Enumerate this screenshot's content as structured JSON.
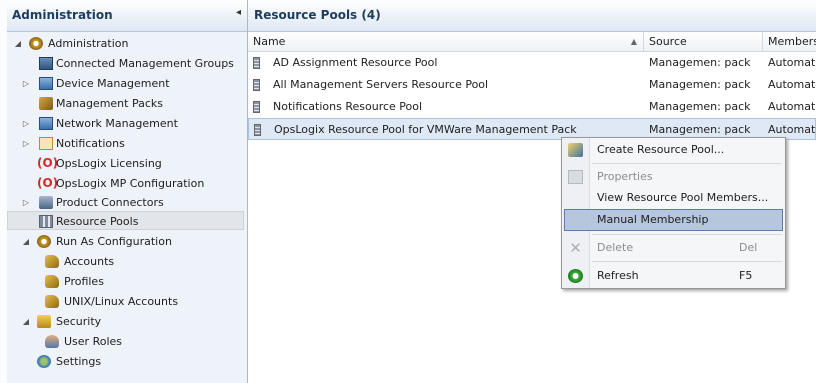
{
  "nav": {
    "title": "Administration",
    "items": [
      {
        "label": "Administration",
        "icon": "gear-icon",
        "expander": "expanded"
      },
      {
        "label": "Connected Management Groups",
        "icon": "management-groups-icon",
        "expander": ""
      },
      {
        "label": "Device Management",
        "icon": "device-icon",
        "expander": "collapsed"
      },
      {
        "label": "Management Packs",
        "icon": "pack-icon",
        "expander": ""
      },
      {
        "label": "Network Management",
        "icon": "network-icon",
        "expander": "collapsed"
      },
      {
        "label": "Notifications",
        "icon": "notification-icon",
        "expander": "collapsed"
      },
      {
        "label": "OpsLogix Licensing",
        "icon": "opslogix-icon",
        "expander": ""
      },
      {
        "label": "OpsLogix MP Configuration",
        "icon": "opslogix-icon",
        "expander": ""
      },
      {
        "label": "Product Connectors",
        "icon": "connector-icon",
        "expander": "collapsed"
      },
      {
        "label": "Resource Pools",
        "icon": "resource-pool-icon",
        "expander": "",
        "selected": true
      },
      {
        "label": "Run As Configuration",
        "icon": "run-as-icon",
        "expander": "expanded"
      },
      {
        "label": "Accounts",
        "icon": "key-icon",
        "expander": ""
      },
      {
        "label": "Profiles",
        "icon": "key-icon",
        "expander": ""
      },
      {
        "label": "UNIX/Linux Accounts",
        "icon": "key-icon",
        "expander": ""
      },
      {
        "label": "Security",
        "icon": "lock-icon",
        "expander": "expanded"
      },
      {
        "label": "User Roles",
        "icon": "user-icon",
        "expander": ""
      },
      {
        "label": "Settings",
        "icon": "settings-icon",
        "expander": ""
      }
    ]
  },
  "content": {
    "title": "Resource Pools (4)",
    "columns": [
      "Name",
      "Source",
      "Membership"
    ],
    "rows": [
      {
        "name": "AD Assignment Resource Pool",
        "source": "Managemen: pack",
        "membership": "Automatic"
      },
      {
        "name": "All Management Servers Resource Pool",
        "source": "Managemen: pack",
        "membership": "Automatic"
      },
      {
        "name": "Notifications Resource Pool",
        "source": "Managemen: pack",
        "membership": "Automatic"
      },
      {
        "name": "OpsLogix Resource Pool for VMWare Management Pack",
        "source": "Managemen: pack",
        "membership": "Automatic",
        "selected": true
      }
    ]
  },
  "context_menu": {
    "items": [
      {
        "label": "Create Resource Pool...",
        "shortcut": "",
        "enabled": true
      },
      {
        "label": "Properties",
        "shortcut": "",
        "enabled": false
      },
      {
        "label": "View Resource Pool Members...",
        "shortcut": "",
        "enabled": true
      },
      {
        "label": "Manual Membership",
        "shortcut": "",
        "enabled": true,
        "highlighted": true
      },
      {
        "label": "Delete",
        "shortcut": "Del",
        "enabled": false
      },
      {
        "label": "Refresh",
        "shortcut": "F5",
        "enabled": true
      }
    ]
  },
  "colors": {
    "header_text": "#1f3c5e",
    "selection": "#dfe9f6",
    "menu_highlight": "#b6c6dd",
    "opslogix": "#d62a2a"
  }
}
